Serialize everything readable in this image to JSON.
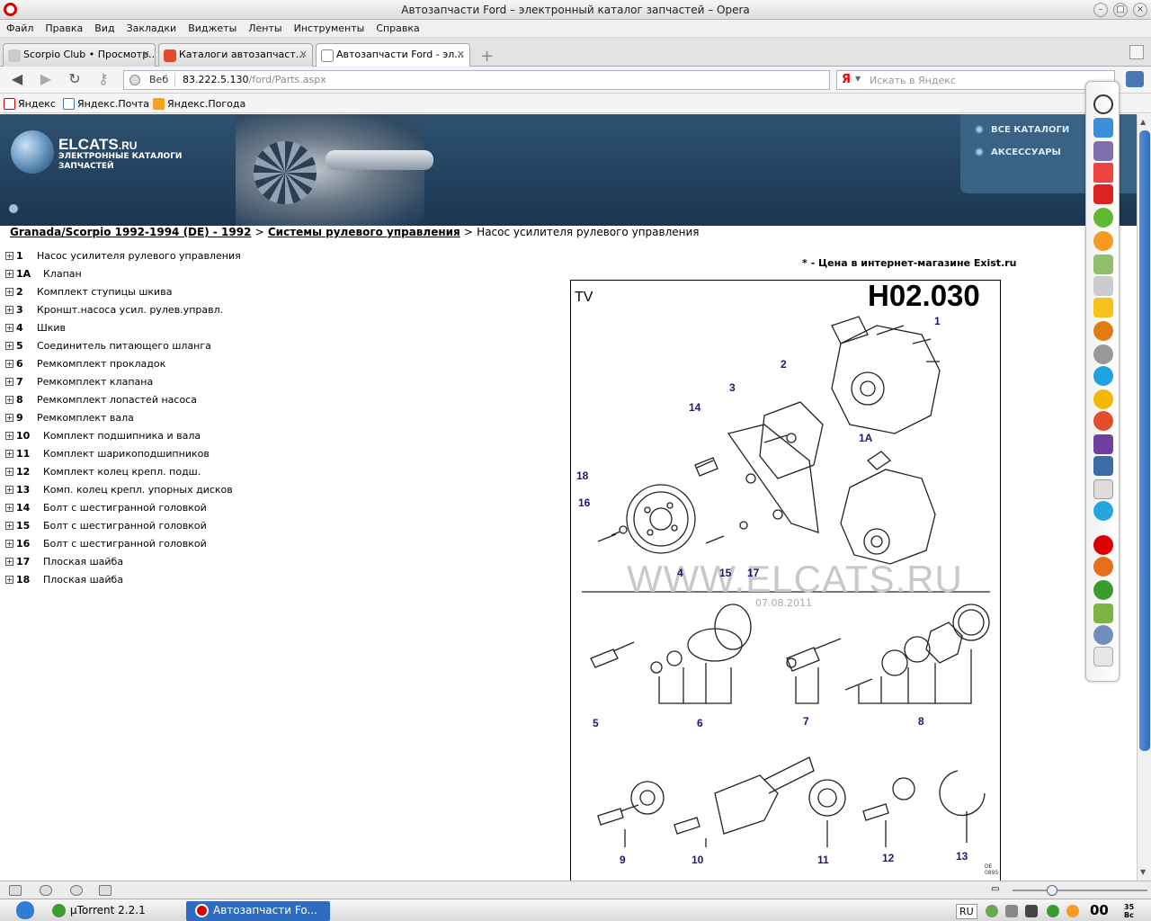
{
  "window": {
    "title": "Автозапчасти Ford – электронный каталог запчастей – Opera"
  },
  "menu": [
    "Файл",
    "Правка",
    "Вид",
    "Закладки",
    "Виджеты",
    "Ленты",
    "Инструменты",
    "Справка"
  ],
  "tabs": [
    {
      "label": "Scorpio Club • Просмотр...",
      "active": false
    },
    {
      "label": "Каталоги автозапчаст...",
      "active": false
    },
    {
      "label": "Автозапчасти Ford - эл...",
      "active": true
    }
  ],
  "address": {
    "scheme": "Веб",
    "host": "83.222.5.130",
    "path": "/ford/Parts.aspx"
  },
  "search": {
    "engine": "Я",
    "placeholder": "Искать в Яндекс"
  },
  "bookmarks": [
    "Яндекс",
    "Яндекс.Почта",
    "Яндекс.Погода"
  ],
  "header": {
    "brand": "ELCATS",
    "brand_suffix": ".RU",
    "subtitle": "ЭЛЕКТРОННЫЕ КАТАЛОГИ ЗАПЧАСТЕЙ",
    "nav": [
      "ВСЕ КАТАЛОГИ",
      "АКСЕССУАРЫ"
    ]
  },
  "breadcrumb": {
    "model": "Granada/Scorpio 1992-1994 (DE) - 1992",
    "group": "Системы рулевого управления",
    "current": "Насос усилителя рулевого управления",
    "sep": ">"
  },
  "parts": [
    {
      "num": "1",
      "name": "Насос усилителя рулевого управления"
    },
    {
      "num": "1A",
      "name": "Клапан"
    },
    {
      "num": "2",
      "name": "Комплект ступицы шкива"
    },
    {
      "num": "3",
      "name": "Кроншт.насоса усил. рулев.управл."
    },
    {
      "num": "4",
      "name": "Шкив"
    },
    {
      "num": "5",
      "name": "Соединитель питающего шланга"
    },
    {
      "num": "6",
      "name": "Ремкомплект прокладок"
    },
    {
      "num": "7",
      "name": "Ремкомплект клапана"
    },
    {
      "num": "8",
      "name": "Ремкомплект лопастей насоса"
    },
    {
      "num": "9",
      "name": "Ремкомплект вала"
    },
    {
      "num": "10",
      "name": "Комплект подшипника и вала"
    },
    {
      "num": "11",
      "name": "Комплект шарикоподшипников"
    },
    {
      "num": "12",
      "name": "Комплект колец крепл. подш."
    },
    {
      "num": "13",
      "name": "Комп. колец крепл. упорных дисков"
    },
    {
      "num": "14",
      "name": "Болт с шестигранной головкой"
    },
    {
      "num": "15",
      "name": "Болт с шестигранной головкой"
    },
    {
      "num": "16",
      "name": "Болт с шестигранной головкой"
    },
    {
      "num": "17",
      "name": "Плоская шайба"
    },
    {
      "num": "18",
      "name": "Плоская шайба"
    }
  ],
  "price_note": "* - Цена в интернет-магазине Exist.ru",
  "diagram": {
    "tv_label": "TV",
    "code": "H02.030",
    "watermark": "WWW.ELCATS.RU",
    "date": "07.08.2011",
    "corner": "DE 0895",
    "callouts": [
      "1",
      "2",
      "3",
      "14",
      "1A",
      "18",
      "16",
      "4",
      "15",
      "17",
      "5",
      "6",
      "7",
      "8",
      "9",
      "10",
      "11",
      "12",
      "13"
    ]
  },
  "taskbar": {
    "items": [
      "µTorrent 2.2.1",
      "Автозапчасти Fo..."
    ],
    "lang": "RU",
    "clock": "00",
    "clock_min": "35",
    "clock_day": "Вс"
  },
  "colors": {
    "header_bg": "#23425f",
    "accent": "#2f6cc0",
    "opera_red": "#dd0000"
  }
}
